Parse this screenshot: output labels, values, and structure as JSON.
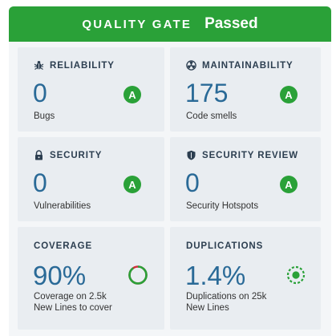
{
  "header": {
    "label": "QUALITY GATE",
    "status": "Passed",
    "color": "#2aa138"
  },
  "cards": {
    "reliability": {
      "title": "RELIABILITY",
      "icon": "bug-icon",
      "value": "0",
      "sub": "Bugs",
      "grade": "A"
    },
    "maintainability": {
      "title": "MAINTAINABILITY",
      "icon": "radiation-icon",
      "value": "175",
      "sub": "Code smells",
      "grade": "A"
    },
    "security": {
      "title": "SECURITY",
      "icon": "lock-icon",
      "value": "0",
      "sub": "Vulnerabilities",
      "grade": "A"
    },
    "security_review": {
      "title": "SECURITY REVIEW",
      "icon": "shield-icon",
      "value": "0",
      "sub": "Security Hotspots",
      "grade": "A"
    },
    "coverage": {
      "title": "COVERAGE",
      "value": "90%",
      "sub_line1": "Coverage on 2.5k",
      "sub_line2": "New Lines to cover",
      "indicator": "coverage-donut-icon",
      "fraction": 0.9
    },
    "duplications": {
      "title": "DUPLICATIONS",
      "value": "1.4%",
      "sub_line1": "Duplications on 25k",
      "sub_line2": "New Lines",
      "indicator": "duplication-level-icon"
    }
  },
  "colors": {
    "grade_a": "#2aa138",
    "value_blue": "#2a6a97",
    "coverage_ok": "#2aa138",
    "coverage_uncovered": "#d02f3a"
  }
}
